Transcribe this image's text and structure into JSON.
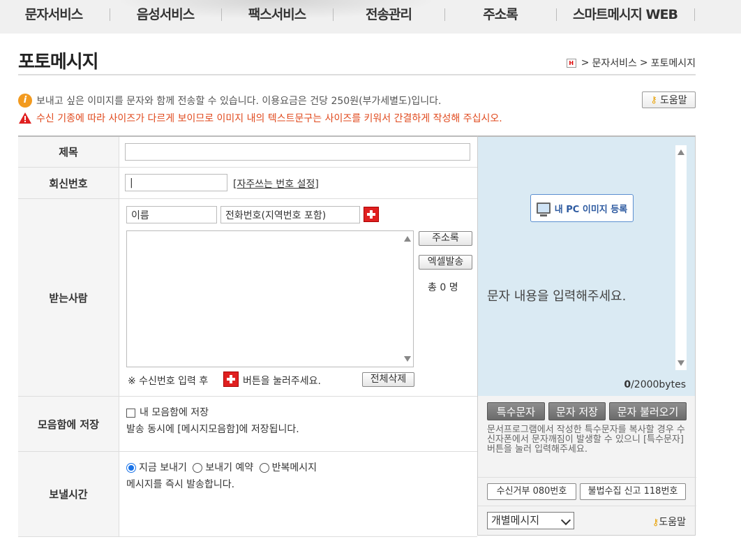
{
  "nav": {
    "items": [
      "문자서비스",
      "음성서비스",
      "팩스서비스",
      "전송관리",
      "주소록",
      "스마트메시지 WEB"
    ]
  },
  "page": {
    "title": "포토메시지",
    "breadcrumb": [
      "문자서비스",
      "포토메시지"
    ],
    "breadcrumb_sep": ">"
  },
  "info": {
    "line1": "보내고 싶은 이미지를 문자와 함께 전송할 수 있습니다. 이용요금은 건당 250원(부가세별도)입니다.",
    "line2": "수신 기종에 따라 사이즈가 다르게 보이므로 이미지 내의 텍스트문구는 사이즈를 키워서 간결하게 작성해 주십시오.",
    "help_label": "도움말"
  },
  "form": {
    "subject_label": "제목",
    "subject_value": "",
    "reply_label": "회신번호",
    "reply_value": "|",
    "reply_link": "[자주쓰는 번호 설정]",
    "recipient_label": "받는사람",
    "name_placeholder": "이름",
    "phone_placeholder": "전화번호(지역번호 포함)",
    "addressbook_btn": "주소록",
    "excel_btn": "엑셀발송",
    "total_count": "총 0 명",
    "hint_prefix": "※ 수신번호 입력 후",
    "hint_suffix": "버튼을 눌러주세요.",
    "delete_all_btn": "전체삭제",
    "save_label": "모음함에 저장",
    "save_checkbox": "내 모음함에 저장",
    "save_desc": "발송 동시에 [메시지모음함]에 저장됩니다.",
    "send_time_label": "보낼시간",
    "send_options": [
      "지금 보내기",
      "보내기 예약",
      "반복메시지"
    ],
    "send_selected": 0,
    "send_desc": "메시지를 즉시 발송합니다."
  },
  "preview": {
    "pc_button": "내 PC 이미지 등록",
    "placeholder": "문자 내용을 입력해주세요.",
    "bytes_current": "0",
    "bytes_suffix": "/2000bytes"
  },
  "tools": {
    "buttons": [
      "특수문자",
      "문자 저장",
      "문자 불러오기"
    ],
    "desc": "문서프로그램에서 작성한 특수문자를 복사할 경우 수신자폰에서 문자깨짐이 발생할 수 있으니 [특수문자] 버튼을 눌러 입력해주세요.",
    "reject_btn": "수신거부 080번호",
    "report_btn": "불법수집 신고 118번호",
    "select_value": "개별메시지",
    "help_label": "도움말"
  }
}
